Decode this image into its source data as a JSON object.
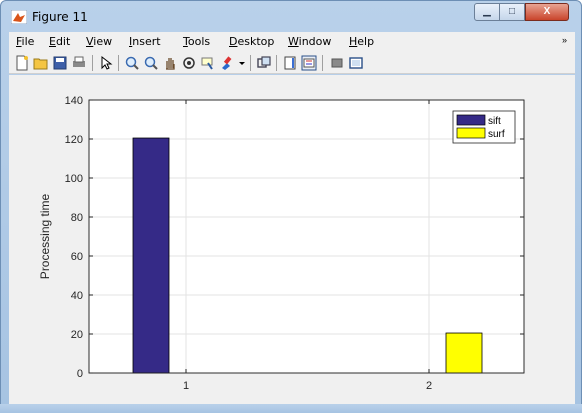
{
  "window": {
    "title": "Figure 11",
    "minimize_glyph": "▁",
    "maximize_glyph": "□",
    "close_glyph": "X"
  },
  "menubar": {
    "items": [
      {
        "label": "File",
        "hotkey": "F"
      },
      {
        "label": "Edit",
        "hotkey": "E"
      },
      {
        "label": "View",
        "hotkey": "V"
      },
      {
        "label": "Insert",
        "hotkey": "I"
      },
      {
        "label": "Tools",
        "hotkey": "T"
      },
      {
        "label": "Desktop",
        "hotkey": "D"
      },
      {
        "label": "Window",
        "hotkey": "W"
      },
      {
        "label": "Help",
        "hotkey": "H"
      }
    ],
    "overflow_glyph": "»"
  },
  "toolbar": {
    "icons": [
      "new-figure-icon",
      "open-file-icon",
      "save-icon",
      "print-icon",
      "pointer-icon",
      "zoom-in-icon",
      "zoom-out-icon",
      "pan-icon",
      "rotate-3d-icon",
      "data-cursor-icon",
      "brush-icon",
      "brush-dropdown-icon",
      "link-plot-icon",
      "colorbar-icon",
      "legend-icon",
      "hide-plot-tools-icon",
      "show-plot-tools-icon"
    ]
  },
  "colors": {
    "sift": "#352a87",
    "surf": "#ffff00",
    "window_chrome": "#b9d1ea",
    "figure_bg": "#f0f0f0"
  },
  "chart_data": {
    "type": "bar",
    "categories": [
      "1",
      "2"
    ],
    "series": [
      {
        "name": "sift",
        "values": [
          120.5,
          0
        ]
      },
      {
        "name": "surf",
        "values": [
          0,
          20.5
        ]
      }
    ],
    "title": "",
    "xlabel": "",
    "ylabel": "Processing time",
    "ylim": [
      0,
      140
    ],
    "yticks": [
      0,
      20,
      40,
      60,
      80,
      100,
      120,
      140
    ],
    "xticks": [
      "1",
      "2"
    ],
    "grid": true,
    "legend": {
      "position": "top-right",
      "entries": [
        "sift",
        "surf"
      ]
    }
  }
}
